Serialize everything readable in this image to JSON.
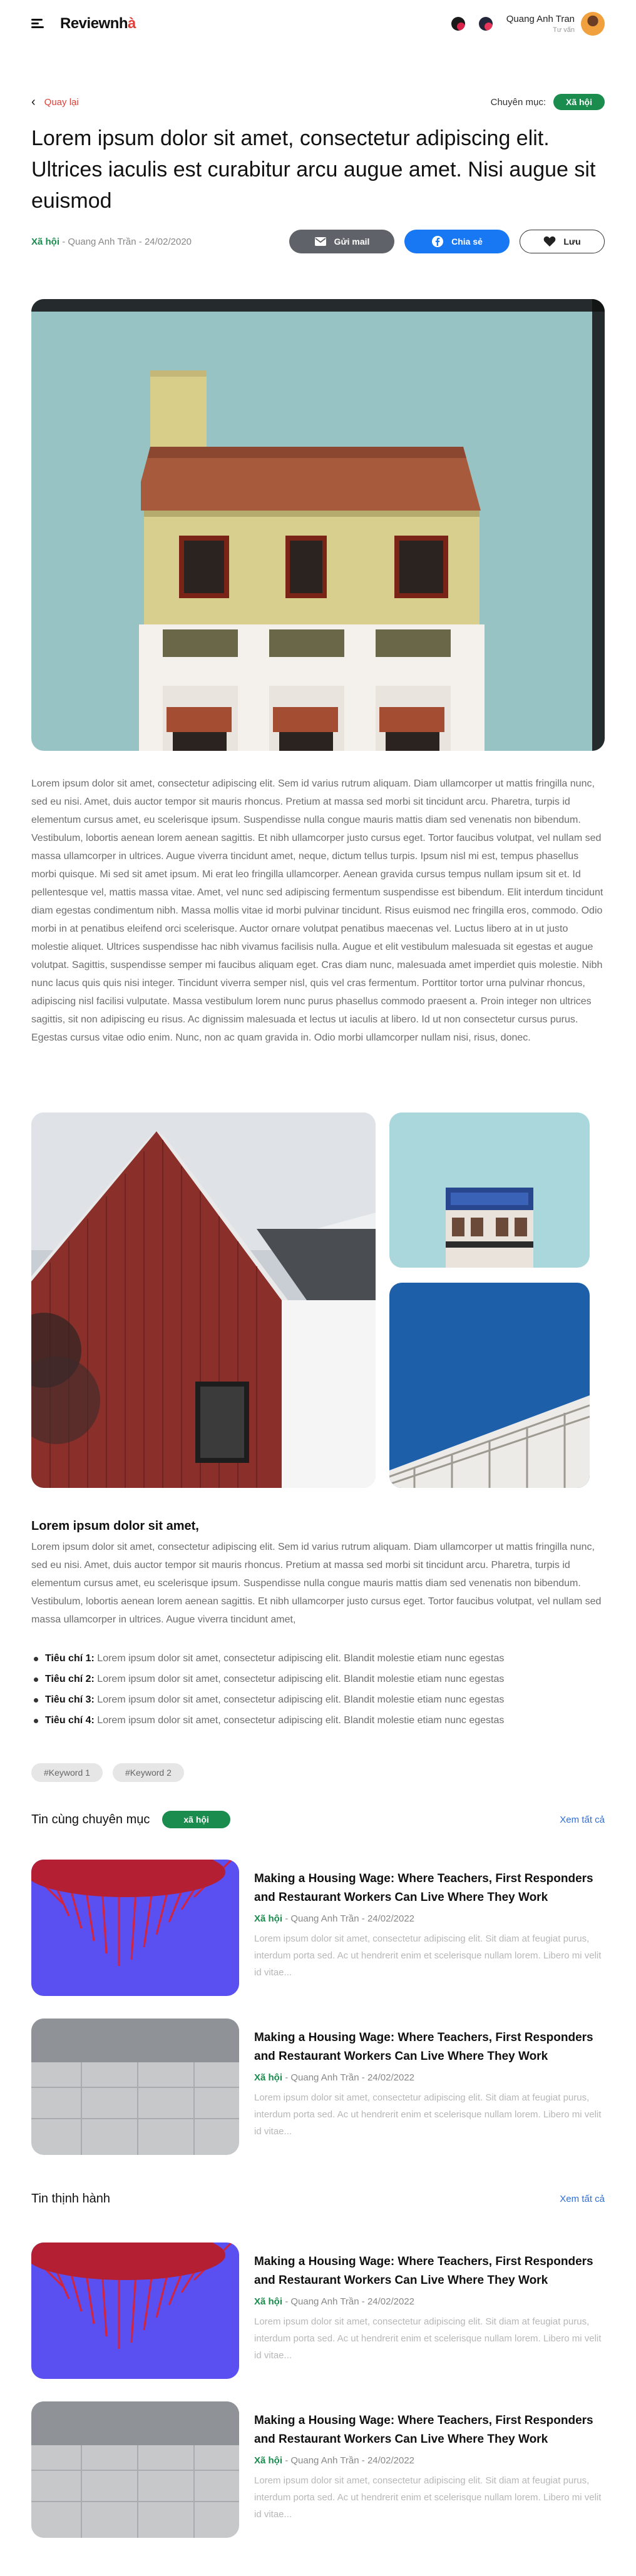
{
  "header": {
    "logo_main": "Reviewnh",
    "logo_accent": "à",
    "user_name": "Quang Anh Tran",
    "user_role": "Tư vấn"
  },
  "nav": {
    "back_label": "Quay lại",
    "category_label": "Chuyên mục:",
    "category_value": "Xã hội"
  },
  "article": {
    "title": "Lorem ipsum dolor sit amet, consectetur adipiscing elit. Ultrices iaculis est curabitur arcu augue amet. Nisi augue sit euismod",
    "category": "Xã hội",
    "author": "Quang Anh Trần",
    "date": "24/02/2020",
    "paragraph1": "Lorem ipsum dolor sit amet, consectetur adipiscing elit. Sem id varius rutrum aliquam. Diam ullamcorper ut mattis fringilla nunc, sed eu nisi. Amet, duis auctor tempor sit mauris rhoncus. Pretium at massa sed morbi sit tincidunt arcu. Pharetra, turpis id elementum cursus amet, eu scelerisque ipsum. Suspendisse nulla congue mauris mattis diam sed venenatis non bibendum. Vestibulum, lobortis aenean lorem aenean sagittis. Et nibh ullamcorper justo cursus eget. Tortor faucibus volutpat, vel nullam sed massa ullamcorper in ultrices. Augue viverra tincidunt amet, neque, dictum tellus turpis. Ipsum nisl mi est, tempus phasellus morbi quisque. Mi sed sit amet ipsum. Mi erat leo fringilla ullamcorper. Aenean gravida cursus tempus nullam ipsum sit et. Id pellentesque vel, mattis massa vitae. Amet, vel nunc sed adipiscing fermentum suspendisse est bibendum. Elit interdum tincidunt diam egestas condimentum nibh. Massa mollis vitae id morbi pulvinar tincidunt. Risus euismod nec fringilla eros, commodo. Odio morbi in at penatibus eleifend orci scelerisque. Auctor ornare volutpat penatibus maecenas vel. Luctus libero at in ut justo molestie aliquet. Ultrices suspendisse hac nibh vivamus facilisis nulla. Augue et elit vestibulum malesuada sit egestas et augue volutpat. Sagittis, suspendisse semper mi faucibus aliquam eget. Cras diam nunc, malesuada amet imperdiet quis molestie. Nibh nunc lacus quis quis nisi integer. Tincidunt viverra semper nisl, quis vel cras fermentum. Porttitor tortor urna pulvinar rhoncus, adipiscing nisl facilisi vulputate. Massa vestibulum lorem nunc purus phasellus commodo praesent a. Proin integer non ultrices sagittis, sit non adipiscing eu risus. Ac dignissim malesuada et lectus ut iaculis at libero. Id ut non consectetur cursus purus. Egestas cursus vitae odio enim. Nunc, non ac quam gravida in. Odio morbi ullamcorper nullam nisi, risus, donec.",
    "subheading": "Lorem ipsum dolor sit amet,",
    "paragraph2": "Lorem ipsum dolor sit amet, consectetur adipiscing elit. Sem id varius rutrum aliquam. Diam ullamcorper ut mattis fringilla nunc, sed eu nisi. Amet, duis auctor tempor sit mauris rhoncus. Pretium at massa sed morbi sit tincidunt arcu. Pharetra, turpis id elementum cursus amet, eu scelerisque ipsum. Suspendisse nulla congue mauris mattis diam sed venenatis non bibendum. Vestibulum, lobortis aenean lorem aenean sagittis. Et nibh ullamcorper justo cursus eget. Tortor faucibus volutpat, vel nullam sed massa ullamcorper in ultrices. Augue viverra tincidunt amet,",
    "bullets": [
      {
        "label": "Tiêu chí 1:",
        "text": " Lorem ipsum dolor sit amet, consectetur adipiscing elit. Blandit molestie etiam nunc egestas"
      },
      {
        "label": "Tiêu chí 2:",
        "text": " Lorem ipsum dolor sit amet, consectetur adipiscing elit. Blandit molestie etiam nunc egestas"
      },
      {
        "label": "Tiêu chí 3:",
        "text": " Lorem ipsum dolor sit amet, consectetur adipiscing elit. Blandit molestie etiam nunc egestas"
      },
      {
        "label": "Tiêu chí 4:",
        "text": " Lorem ipsum dolor sit amet, consectetur adipiscing elit. Blandit molestie etiam nunc egestas"
      }
    ],
    "tags": [
      "#Keyword 1",
      "#Keyword 2"
    ]
  },
  "share": {
    "email_label": "Gửi mail",
    "facebook_label": "Chia sẻ",
    "save_label": "Lưu"
  },
  "related": {
    "title": "Tin cùng chuyên mục",
    "pill": "xã hội",
    "see_all": "Xem tất cả",
    "items": [
      {
        "title": "Making a Housing Wage: Where Teachers, First Responders and Restaurant Workers Can Live Where They Work",
        "category": "Xã hội",
        "author": "Quang Anh Trần",
        "date": "24/02/2022",
        "desc": "Lorem ipsum dolor sit amet, consectetur adipiscing elit. Sit diam at feugiat purus, interdum porta sed. Ac ut hendrerit enim et scelerisque nullam lorem. Libero mi velit id vitae..."
      },
      {
        "title": "Making a Housing Wage: Where Teachers, First Responders and Restaurant Workers Can Live Where They Work",
        "category": "Xã hội",
        "author": "Quang Anh Trần",
        "date": "24/02/2022",
        "desc": "Lorem ipsum dolor sit amet, consectetur adipiscing elit. Sit diam at feugiat purus, interdum porta sed. Ac ut hendrerit enim et scelerisque nullam lorem. Libero mi velit id vitae..."
      }
    ]
  },
  "trending": {
    "title": "Tin thịnh hành",
    "see_all": "Xem tất cả",
    "items": [
      {
        "title": "Making a Housing Wage: Where Teachers, First Responders and Restaurant Workers Can Live Where They Work",
        "category": "Xã hội",
        "author": "Quang Anh Trần",
        "date": "24/02/2022",
        "desc": "Lorem ipsum dolor sit amet, consectetur adipiscing elit. Sit diam at feugiat purus, interdum porta sed. Ac ut hendrerit enim et scelerisque nullam lorem. Libero mi velit id vitae..."
      },
      {
        "title": "Making a Housing Wage: Where Teachers, First Responders and Restaurant Workers Can Live Where They Work",
        "category": "Xã hội",
        "author": "Quang Anh Trần",
        "date": "24/02/2022",
        "desc": "Lorem ipsum dolor sit amet, consectetur adipiscing elit. Sit diam at feugiat purus, interdum porta sed. Ac ut hendrerit enim et scelerisque nullam lorem. Libero mi velit id vitae..."
      }
    ]
  },
  "colors": {
    "accent_green": "#1a8c4e",
    "accent_red": "#e0403a",
    "link_blue": "#2f6ed8",
    "facebook_blue": "#1877f2"
  }
}
